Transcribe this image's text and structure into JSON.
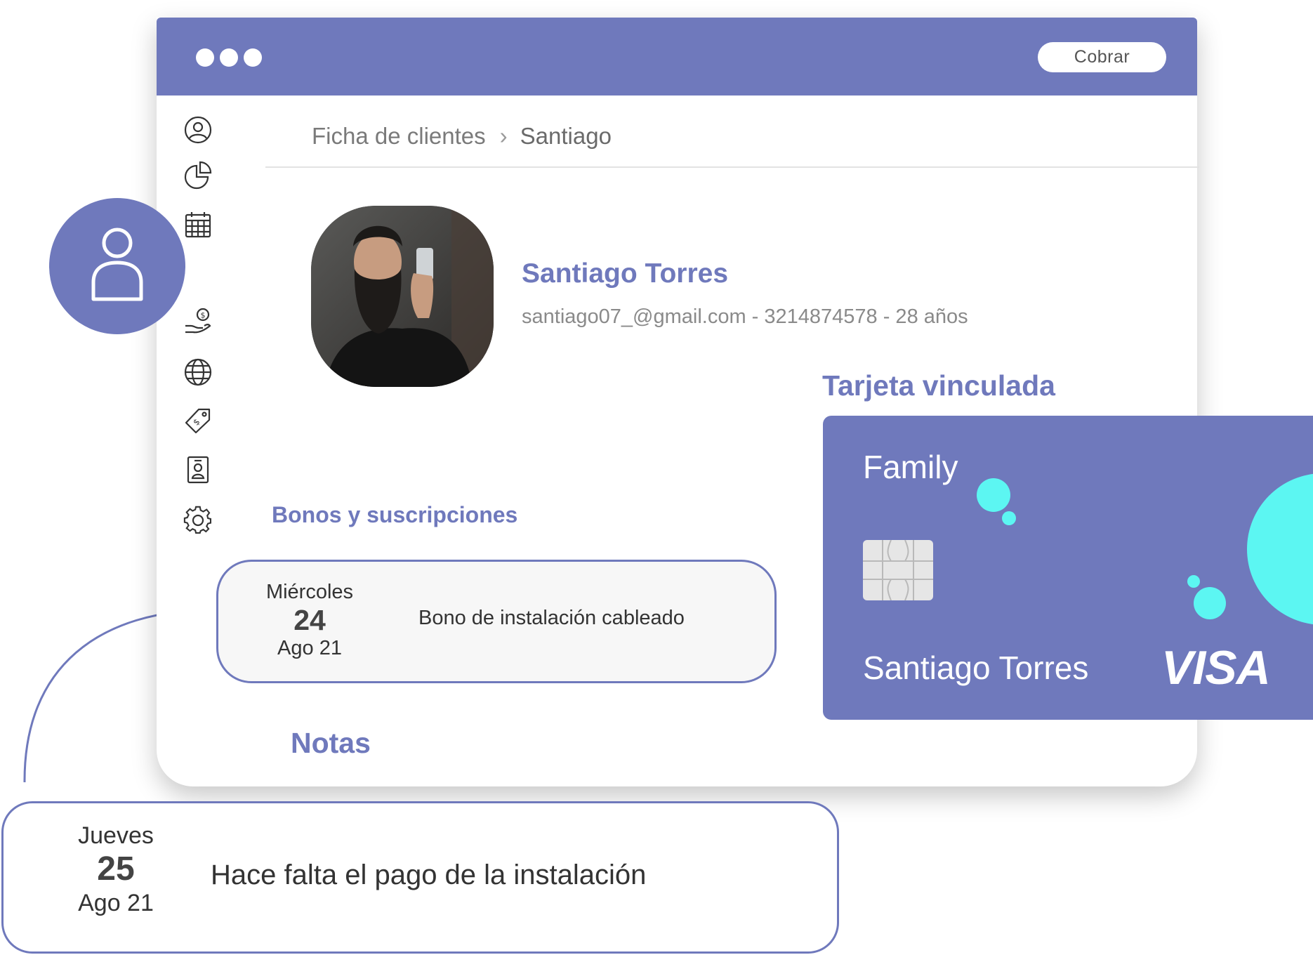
{
  "colors": {
    "accent": "#6f79bc",
    "accent_cyan": "#5cf6f2",
    "text_dark": "#333333",
    "text_muted": "#8a8a8a",
    "white": "#ffffff"
  },
  "titlebar": {
    "cobrar_label": "Cobrar"
  },
  "sidebar": {
    "items": [
      {
        "icon": "user-circle-icon"
      },
      {
        "icon": "pie-chart-icon"
      },
      {
        "icon": "calendar-icon"
      },
      {
        "icon": "hand-money-icon"
      },
      {
        "icon": "globe-icon"
      },
      {
        "icon": "price-tag-icon"
      },
      {
        "icon": "id-badge-icon"
      },
      {
        "icon": "gear-icon"
      }
    ]
  },
  "breadcrumb": {
    "parent": "Ficha de clientes",
    "current": "Santiago"
  },
  "client": {
    "name": "Santiago Torres",
    "info": "santiago07_@gmail.com - 3214874578 - 28 años"
  },
  "sections": {
    "tarjeta": "Tarjeta vinculada",
    "bonos": "Bonos y suscripciones",
    "notas": "Notas"
  },
  "card": {
    "plan": "Family",
    "holder": "Santiago Torres",
    "brand": "VISA"
  },
  "bono": {
    "weekday": "Miércoles",
    "day": "24",
    "month": "Ago 21",
    "description": "Bono de instalación cableado"
  },
  "note": {
    "weekday": "Jueves",
    "day": "25",
    "month": "Ago 21",
    "text": "Hace falta el pago de la instalación"
  }
}
